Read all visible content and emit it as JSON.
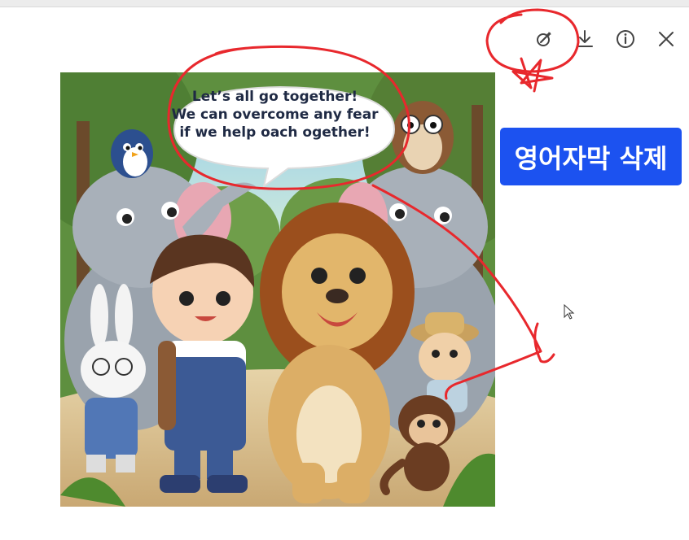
{
  "toolbar": {
    "edit_icon": "magic-edit-icon",
    "download_icon": "download-icon",
    "info_icon": "info-icon",
    "close_icon": "close-icon"
  },
  "image": {
    "speech_bubble": {
      "line1": "Let’s all go together!",
      "line2": "We can overcome any fear",
      "line3": "if we help oach ogether!"
    }
  },
  "badge": {
    "label": "영어자막 삭제",
    "color": "#1c52f0"
  },
  "annotations": {
    "color": "#e8282d"
  }
}
